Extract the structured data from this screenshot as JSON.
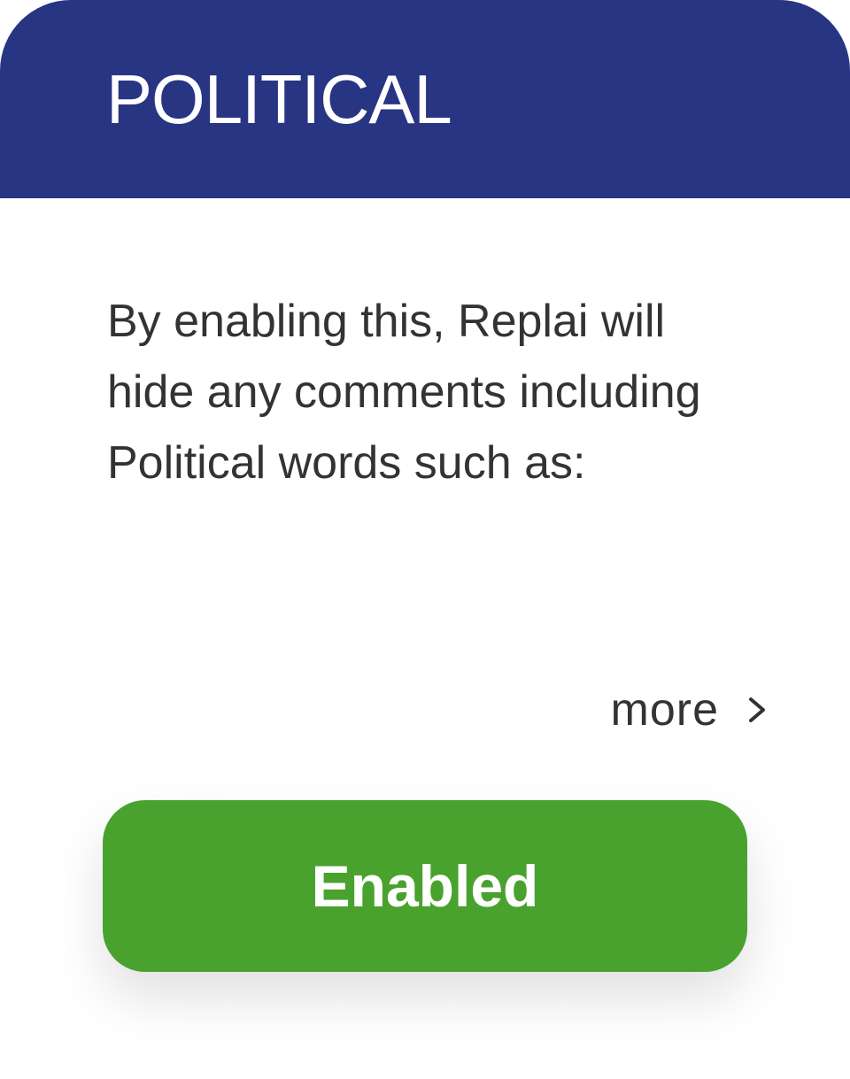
{
  "card": {
    "title": "POLITICAL",
    "description": "By enabling this, Replai will hide any comments including Political words such as:",
    "more_label": "more",
    "more_icon": "chevron-right-icon",
    "button_label": "Enabled"
  },
  "colors": {
    "header": "#283582",
    "button": "#4aa22e",
    "text": "#333333"
  }
}
